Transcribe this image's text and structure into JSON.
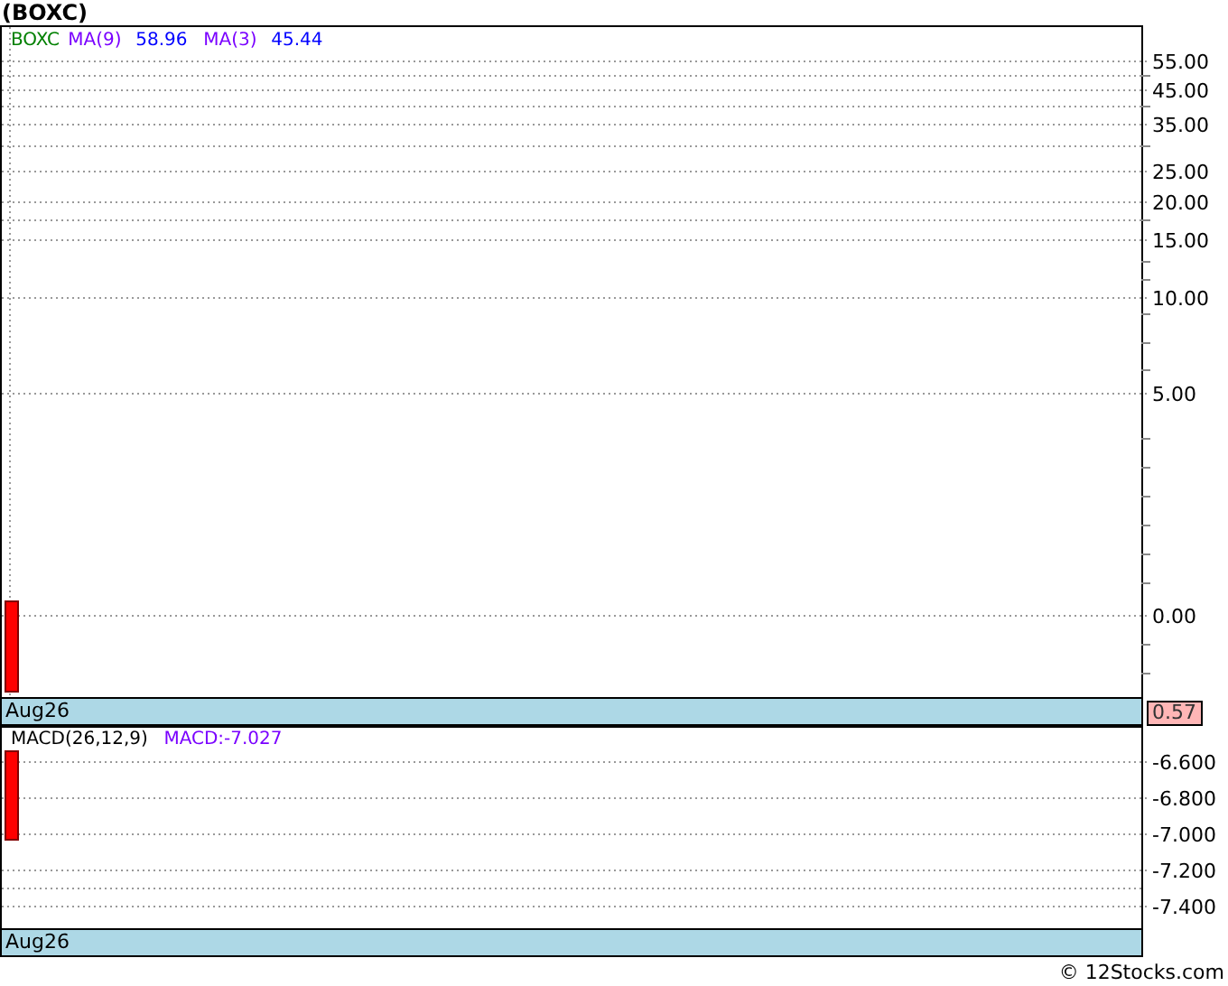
{
  "title": "(BOXC)",
  "price_panel": {
    "legend": [
      {
        "text": "BOXC",
        "kind": "symbol"
      },
      {
        "text": "MA(9)",
        "kind": "indicator"
      },
      {
        "text": "58.96",
        "kind": "value"
      },
      {
        "text": "MA(3)",
        "kind": "indicator"
      },
      {
        "text": "45.44",
        "kind": "value"
      }
    ],
    "axis_labels": [
      "55.00",
      "45.00",
      "35.00",
      "25.00",
      "20.00",
      "15.00",
      "10.00",
      "5.00",
      "0.00"
    ],
    "date_label": "Aug26",
    "last_price": "0.57"
  },
  "macd_panel": {
    "legend": [
      {
        "text": "MACD(26,12,9)",
        "kind": "name"
      },
      {
        "text": "MACD:-7.027",
        "kind": "indicator"
      }
    ],
    "axis_labels": [
      "-6.600",
      "-6.800",
      "-7.000",
      "-7.200",
      "-7.400"
    ],
    "date_label": "Aug26"
  },
  "footer": "© 12Stocks.com"
}
